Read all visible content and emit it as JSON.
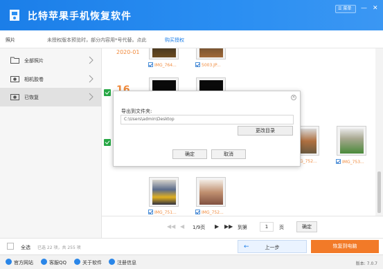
{
  "app": {
    "title": "比特苹果手机恢复软件",
    "menu_label": "菜单",
    "minimize": "—",
    "close": "✕"
  },
  "notice": {
    "category": "照片",
    "message": "未授权版本预览时，部分内容用*号代替。点此",
    "buy_link": "购买授权"
  },
  "sidebar": {
    "items": [
      {
        "label": "全部照片",
        "icon": "folder-icon",
        "active": false
      },
      {
        "label": "相机胶卷",
        "icon": "camera-icon",
        "active": false
      },
      {
        "label": "已恢复",
        "icon": "camera-icon",
        "active": true
      }
    ]
  },
  "content": {
    "date_group_1": "2020-01",
    "date_group_2": "16",
    "captions": [
      "IMG_764...",
      "5003.JP...",
      "IMG_752...",
      "IMG_753...",
      "IMG_751...",
      "IMG_752..."
    ]
  },
  "pager": {
    "first": "◀◀",
    "prev": "◀",
    "page_info": "1/9页",
    "next": "▶",
    "last": "▶▶",
    "goto_label": "到第",
    "page_input": "1",
    "page_unit": "页",
    "confirm": "确定"
  },
  "actionbar": {
    "select_all": "全选",
    "selection_count": "已选 22 项，共 255 项",
    "prev_step": "上一步",
    "recover": "恢复到电脑"
  },
  "footer": {
    "links": [
      "官方网站",
      "客服QQ",
      "关于软件",
      "注册信息"
    ],
    "version": "版本: 7.0.7"
  },
  "dialog": {
    "label": "导出到文件夹:",
    "path": "C:\\Users\\admin\\Desktop",
    "change_dir": "更改目录",
    "ok": "确定",
    "cancel": "取消"
  },
  "colors": {
    "brand_blue": "#1b7ee8",
    "accent_orange": "#f27a28",
    "check_green": "#27a845"
  }
}
